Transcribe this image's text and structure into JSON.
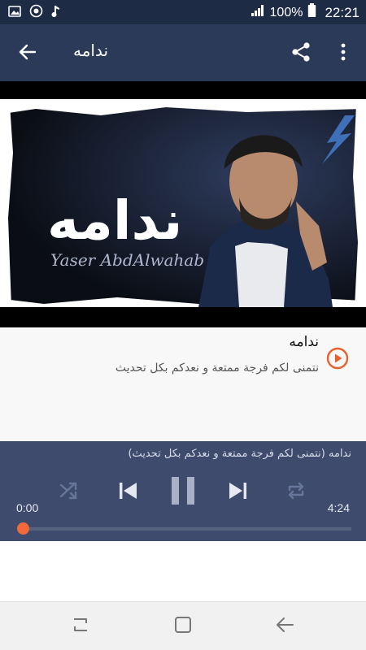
{
  "status_bar": {
    "battery": "100%",
    "time": "22:21",
    "icons": [
      "image-icon",
      "screen-record-icon",
      "music-note-icon",
      "signal-icon",
      "battery-icon"
    ]
  },
  "app_bar": {
    "title": "ندامه",
    "icons": [
      "arrow-back-icon",
      "share-icon",
      "more-vert-icon"
    ]
  },
  "artwork": {
    "text": "ندامه",
    "signature": "Yaser AbdAlwahab"
  },
  "track": {
    "title": "ندامه",
    "description": "نتمنى لكم فرجة ممتعة و نعدكم بكل تحديث",
    "play_icon": "play-circle-icon"
  },
  "player": {
    "now_playing": "ندامه (نتمنى لكم فرجة ممتعة و نعدكم بكل تحديث)",
    "current_time": "0:00",
    "total_time": "4:24",
    "progress": 0,
    "controls": [
      "shuffle-icon",
      "skip-previous-icon",
      "pause-icon",
      "skip-next-icon",
      "repeat-icon"
    ]
  },
  "colors": {
    "status_bar": "#1e2b45",
    "app_bar": "#2b3a59",
    "player": "#3e4b6c",
    "accent": "#f26a3c"
  }
}
